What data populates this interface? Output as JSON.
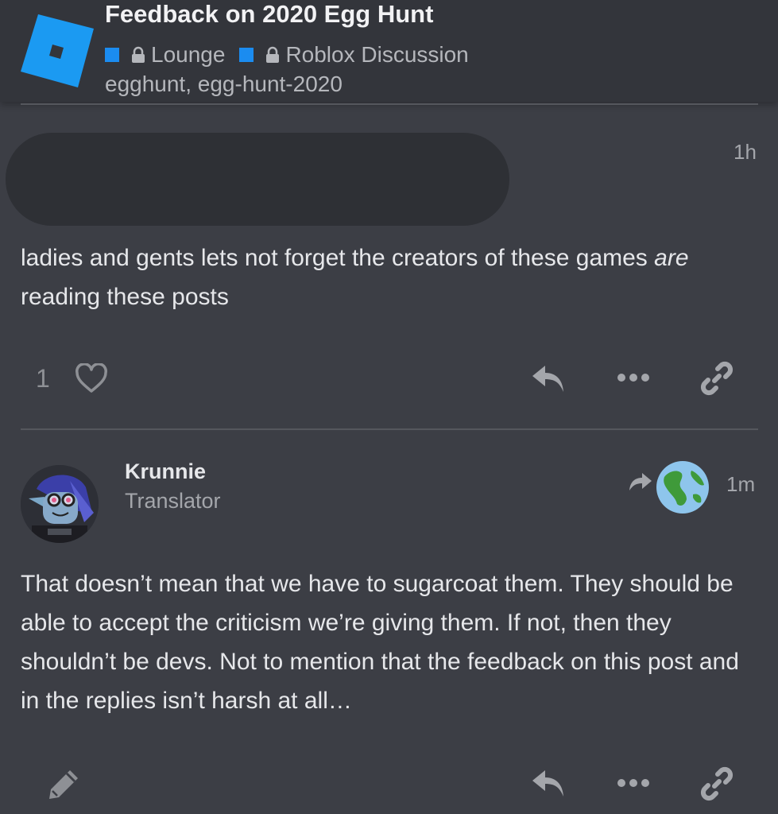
{
  "topic": {
    "title": "Feedback on 2020 Egg Hunt",
    "categories": [
      {
        "label": "Lounge",
        "color": "#1b8cf0"
      },
      {
        "label": "Roblox Discussion",
        "color": "#1b8cf0"
      }
    ],
    "tags": "egghunt, egg-hunt-2020"
  },
  "posts": [
    {
      "time": "1h",
      "text_before": "ladies and gents lets not forget the creators of these games ",
      "text_em": "are",
      "text_after": " reading these posts",
      "likes": "1"
    },
    {
      "username": "Krunnie",
      "user_title": "Translator",
      "time": "1m",
      "text": "That doesn’t mean that we have to sugarcoat them. They should be able to accept the criticism we’re giving them. If not, then they shouldn’t be devs. Not to mention that the feedback on this post and in the replies isn’t harsh at all…"
    }
  ],
  "icons": {
    "logo": "roblox-logo",
    "lock": "lock-icon",
    "heart": "heart-icon",
    "reply": "reply-icon",
    "more": "more-icon",
    "link": "link-icon",
    "edit": "pencil-icon",
    "reply_to": "reply-arrow-icon",
    "globe": "globe-icon"
  },
  "colors": {
    "accent": "#1b8cf0",
    "background": "#3c3e45",
    "header": "#33353b"
  }
}
